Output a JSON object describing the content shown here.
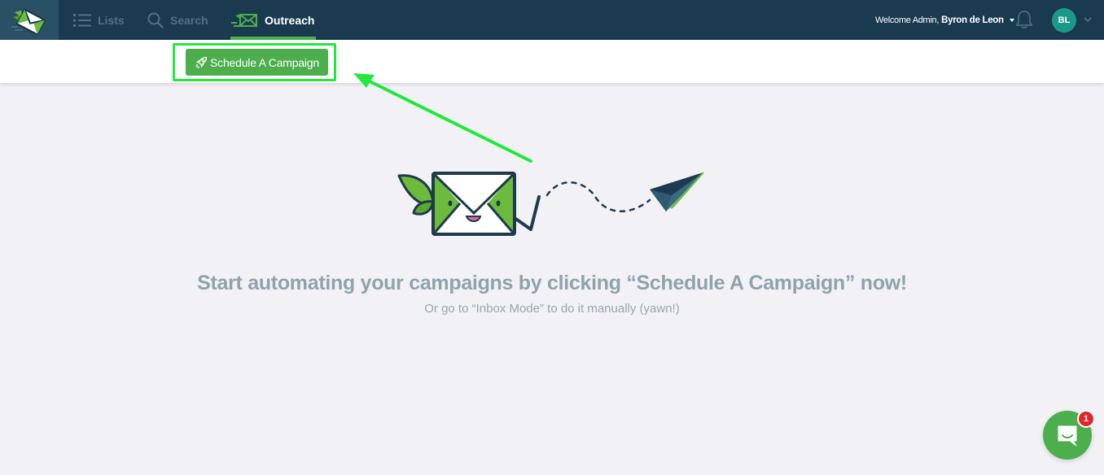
{
  "nav": {
    "items": [
      {
        "label": "Lists",
        "icon": "list-icon",
        "active": false
      },
      {
        "label": "Search",
        "icon": "search-icon",
        "active": false
      },
      {
        "label": "Outreach",
        "icon": "outreach-mail-icon",
        "active": true
      }
    ]
  },
  "user": {
    "welcome_prefix": "Welcome Admin,",
    "name": "Byron de Leon",
    "initials": "BL"
  },
  "toolbar": {
    "schedule_label": "Schedule A Campaign",
    "schedule_icon": "rocket-icon"
  },
  "empty_state": {
    "headline": "Start automating your campaigns by clicking “Schedule A Campaign” now!",
    "subline": "Or go to “Inbox Mode” to do it manually (yawn!)"
  },
  "chat": {
    "unread_count": "1"
  },
  "colors": {
    "topbar": "#1a3a50",
    "accent_green": "#4cae4c",
    "annotation_green": "#22e83e",
    "avatar": "#1a9a86",
    "badge_red": "#e0252d"
  }
}
